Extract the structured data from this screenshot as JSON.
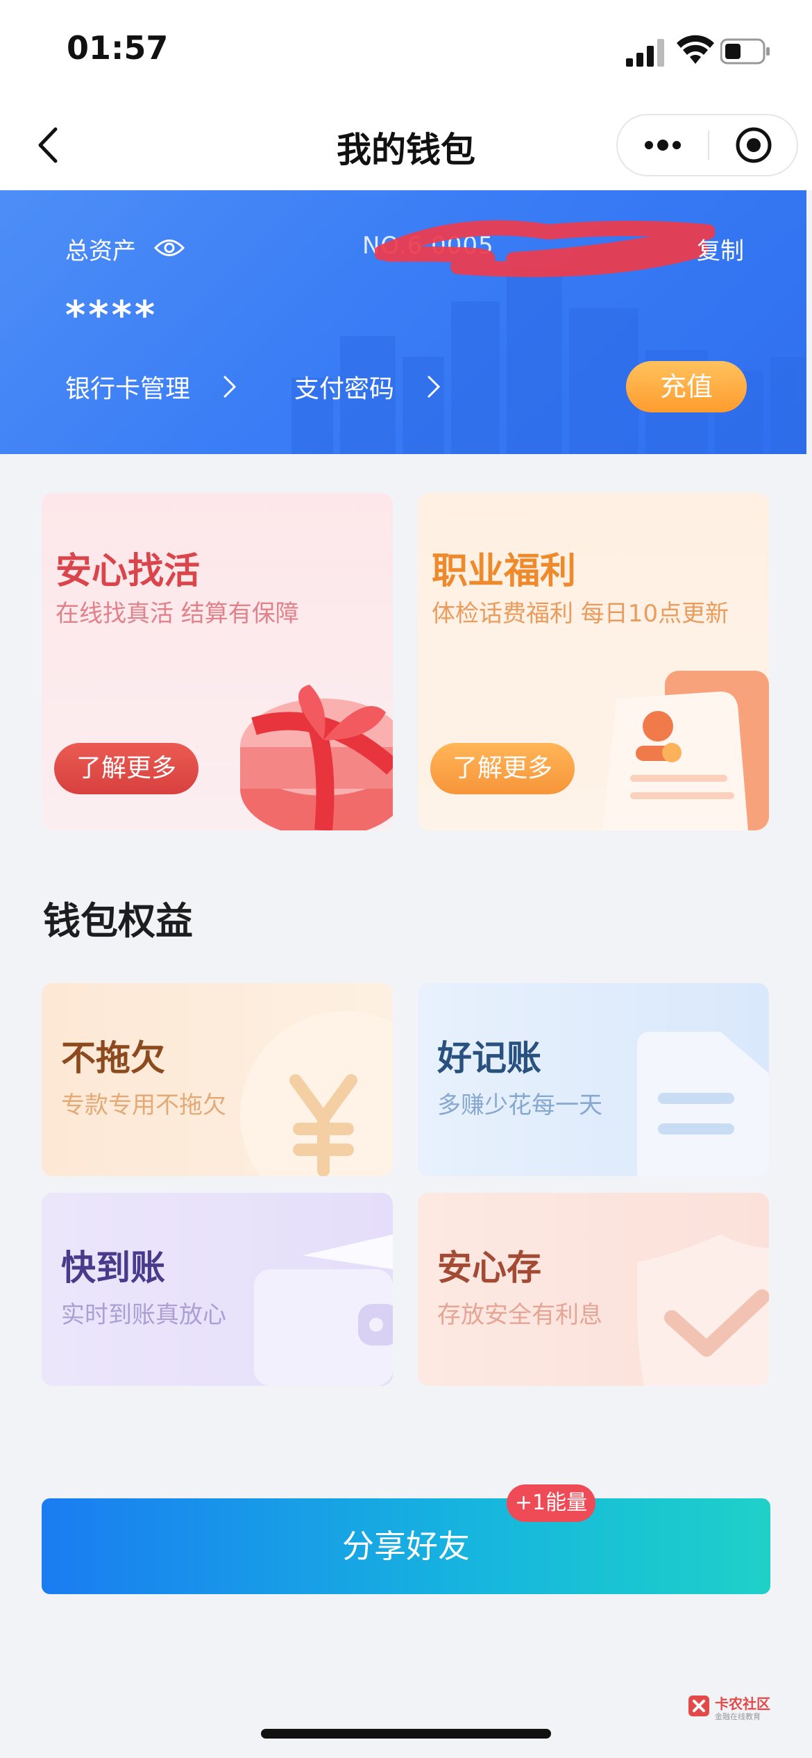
{
  "status_bar": {
    "time": "01:57"
  },
  "nav": {
    "title": "我的钱包"
  },
  "wallet": {
    "asset_label": "总资产",
    "account_no": "NO.6                               0005",
    "copy_label": "复制",
    "asset_value": "****",
    "bank_card_label": "银行卡管理",
    "pay_password_label": "支付密码",
    "recharge_label": "充值"
  },
  "promos": [
    {
      "title": "安心找活",
      "desc": "在线找真活 结算有保障",
      "button": "了解更多"
    },
    {
      "title": "职业福利",
      "desc": "体检话费福利 每日10点更新",
      "button": "了解更多"
    }
  ],
  "benefits_section": {
    "title": "钱包权益",
    "items": [
      {
        "title": "不拖欠",
        "desc": "专款专用不拖欠"
      },
      {
        "title": "好记账",
        "desc": "多赚少花每一天"
      },
      {
        "title": "快到账",
        "desc": "实时到账真放心"
      },
      {
        "title": "安心存",
        "desc": "存放安全有利息"
      }
    ]
  },
  "share": {
    "label": "分享好友",
    "badge": "+1能量"
  },
  "watermark": {
    "name": "卡农社区",
    "sub": "金融在线教育"
  },
  "colors": {
    "header_blue": "#3a7df5",
    "recharge_orange": "#ff9c2e",
    "share_start": "#1a7cf2",
    "share_end": "#1ed1c8",
    "badge_red": "#ee4b57"
  }
}
